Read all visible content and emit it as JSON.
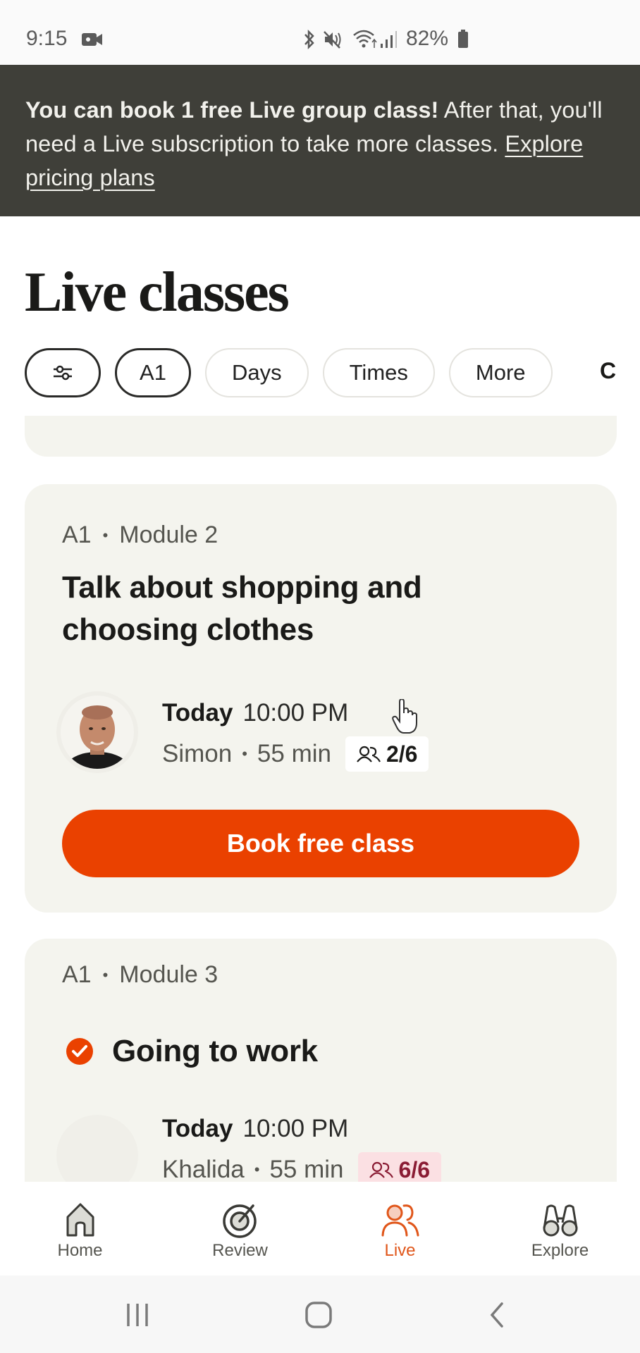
{
  "status_bar": {
    "time": "9:15",
    "battery": "82%",
    "icons": [
      "video-recording-icon",
      "bluetooth-icon",
      "mute-icon",
      "wifi-icon",
      "signal-icon",
      "battery-icon"
    ]
  },
  "banner": {
    "bold_text": "You can book 1 free Live group class!",
    "text": " After that, you'll need a Live subscription to take more classes. ",
    "link_text": "Explore pricing plans"
  },
  "page": {
    "title": "Live classes"
  },
  "filters": {
    "icon": "sliders-icon",
    "chips": [
      {
        "label": "A1",
        "selected": true
      },
      {
        "label": "Days",
        "selected": false
      },
      {
        "label": "Times",
        "selected": false
      },
      {
        "label": "More",
        "selected": false
      }
    ],
    "partial_chip": "C"
  },
  "classes": [
    {
      "level": "A1",
      "module": "Module 2",
      "title": "Talk about shopping and choosing clothes",
      "completed": false,
      "day": "Today",
      "time": "10:00 PM",
      "teacher": "Simon",
      "duration": "55 min",
      "seats": "2/6",
      "seats_full": false,
      "action_label": "Book free class"
    },
    {
      "level": "A1",
      "module": "Module 3",
      "title": "Going to work",
      "completed": true,
      "day": "Today",
      "time": "10:00 PM",
      "teacher": "Khalida",
      "duration": "55 min",
      "seats": "6/6",
      "seats_full": true
    }
  ],
  "bottom_nav": {
    "items": [
      {
        "label": "Home",
        "icon": "home-icon",
        "active": false
      },
      {
        "label": "Review",
        "icon": "target-icon",
        "active": false
      },
      {
        "label": "Live",
        "icon": "people-icon",
        "active": true
      },
      {
        "label": "Explore",
        "icon": "binoculars-icon",
        "active": false
      }
    ]
  },
  "colors": {
    "accent": "#ea4100",
    "banner_bg": "#3f3f39",
    "card_bg": "#f4f4ee",
    "full_badge_bg": "#fbe0e3",
    "full_badge_text": "#8a1c34",
    "nav_active": "#e0561a"
  }
}
